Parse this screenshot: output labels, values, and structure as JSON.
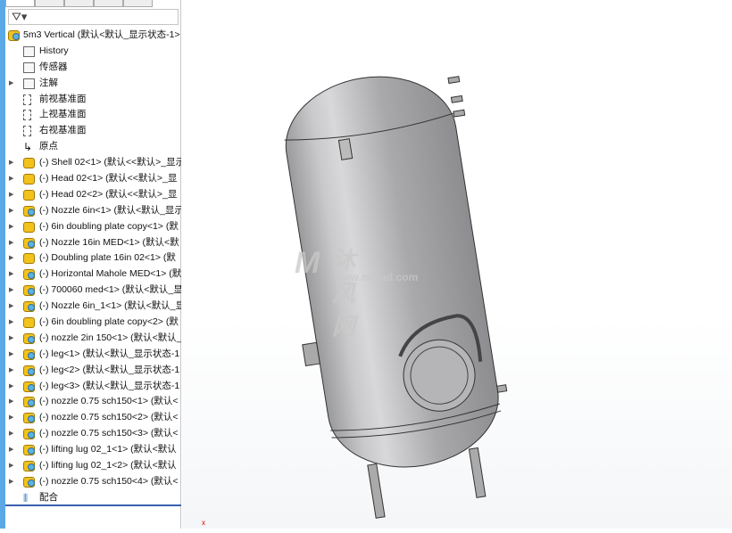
{
  "filter": {
    "icon": "filter-icon"
  },
  "tree": {
    "root": "5m3 Vertical  (默认<默认_显示状态-1>",
    "items": [
      {
        "label": "History",
        "icon": "history-folder-icon",
        "exp": false
      },
      {
        "label": "传感器",
        "icon": "sensor-folder-icon",
        "exp": false
      },
      {
        "label": "注解",
        "icon": "annotation-folder-icon",
        "exp": true
      },
      {
        "label": "前视基准面",
        "icon": "plane-icon",
        "exp": false
      },
      {
        "label": "上视基准面",
        "icon": "plane-icon",
        "exp": false
      },
      {
        "label": "右视基准面",
        "icon": "plane-icon",
        "exp": false
      },
      {
        "label": "原点",
        "icon": "origin-icon",
        "exp": false
      },
      {
        "label": "(-) Shell 02<1> (默认<<默认>_显示",
        "icon": "part-icon",
        "exp": true
      },
      {
        "label": "(-) Head 02<1> (默认<<默认>_显",
        "icon": "part-icon",
        "exp": true
      },
      {
        "label": "(-) Head 02<2> (默认<<默认>_显",
        "icon": "part-icon",
        "exp": true
      },
      {
        "label": "(-) Nozzle 6in<1> (默认<默认_显示",
        "icon": "assembly-icon",
        "exp": true
      },
      {
        "label": "(-) 6in doubling plate copy<1> (默",
        "icon": "part-icon",
        "exp": true
      },
      {
        "label": "(-) Nozzle 16in MED<1> (默认<默",
        "icon": "assembly-icon",
        "exp": true
      },
      {
        "label": "(-) Doubling plate 16in 02<1> (默",
        "icon": "part-icon",
        "exp": true
      },
      {
        "label": "(-) Horizontal Mahole MED<1> (默",
        "icon": "assembly-icon",
        "exp": true
      },
      {
        "label": "(-) 700060 med<1> (默认<默认_显",
        "icon": "assembly-icon",
        "exp": true
      },
      {
        "label": "(-) Nozzle 6in_1<1> (默认<默认_显",
        "icon": "assembly-icon",
        "exp": true
      },
      {
        "label": "(-) 6in doubling plate copy<2> (默",
        "icon": "part-icon",
        "exp": true
      },
      {
        "label": "(-) nozzle 2in 150<1> (默认<默认_",
        "icon": "assembly-icon",
        "exp": true
      },
      {
        "label": "(-) leg<1> (默认<默认_显示状态-1",
        "icon": "assembly-icon",
        "exp": true
      },
      {
        "label": "(-) leg<2> (默认<默认_显示状态-1",
        "icon": "assembly-icon",
        "exp": true
      },
      {
        "label": "(-) leg<3> (默认<默认_显示状态-1",
        "icon": "assembly-icon",
        "exp": true
      },
      {
        "label": "(-) nozzle 0.75 sch150<1> (默认<",
        "icon": "assembly-icon",
        "exp": true
      },
      {
        "label": "(-) nozzle 0.75 sch150<2> (默认<",
        "icon": "assembly-icon",
        "exp": true
      },
      {
        "label": "(-) nozzle 0.75 sch150<3> (默认<",
        "icon": "assembly-icon",
        "exp": true
      },
      {
        "label": "(-) lifting lug 02_1<1> (默认<默认",
        "icon": "assembly-icon",
        "exp": true
      },
      {
        "label": "(-) lifting lug 02_1<2> (默认<默认",
        "icon": "assembly-icon",
        "exp": true
      },
      {
        "label": "(-) nozzle 0.75 sch150<4> (默认<",
        "icon": "assembly-icon",
        "exp": true
      },
      {
        "label": "配合",
        "icon": "mates-icon",
        "exp": false
      }
    ]
  },
  "watermark": {
    "name": "沐风网",
    "url": "www.mfcad.com"
  },
  "viewport": {
    "axis_label": "x"
  }
}
